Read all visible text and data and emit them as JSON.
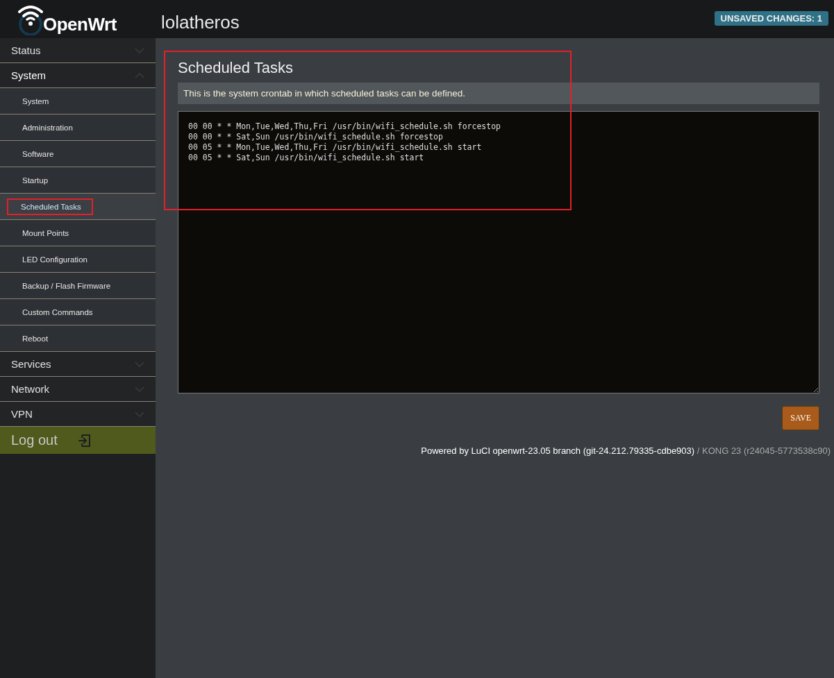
{
  "header": {
    "logo_text": "OpenWrt",
    "hostname": "lolatheros",
    "badge": "UNSAVED CHANGES: 1"
  },
  "sidebar": {
    "items": [
      {
        "label": "Status",
        "expanded": false
      },
      {
        "label": "System",
        "expanded": true,
        "children": [
          {
            "label": "System",
            "selected": false,
            "annotated": false
          },
          {
            "label": "Administration",
            "selected": false,
            "annotated": false
          },
          {
            "label": "Software",
            "selected": false,
            "annotated": false
          },
          {
            "label": "Startup",
            "selected": false,
            "annotated": false
          },
          {
            "label": "Scheduled Tasks",
            "selected": true,
            "annotated": true
          },
          {
            "label": "Mount Points",
            "selected": false,
            "annotated": false
          },
          {
            "label": "LED Configuration",
            "selected": false,
            "annotated": false
          },
          {
            "label": "Backup / Flash Firmware",
            "selected": false,
            "annotated": false
          },
          {
            "label": "Custom Commands",
            "selected": false,
            "annotated": false
          },
          {
            "label": "Reboot",
            "selected": false,
            "annotated": false
          }
        ]
      },
      {
        "label": "Services",
        "expanded": false
      },
      {
        "label": "Network",
        "expanded": false
      },
      {
        "label": "VPN",
        "expanded": false
      }
    ],
    "logout": "Log out"
  },
  "page": {
    "title": "Scheduled Tasks",
    "annotated": true,
    "description": "This is the system crontab in which scheduled tasks can be defined.",
    "crontab": "00 00 * * Mon,Tue,Wed,Thu,Fri /usr/bin/wifi_schedule.sh forcestop\n00 00 * * Sat,Sun /usr/bin/wifi_schedule.sh forcestop\n00 05 * * Mon,Tue,Wed,Thu,Fri /usr/bin/wifi_schedule.sh start\n00 05 * * Sat,Sun /usr/bin/wifi_schedule.sh start",
    "save_button": "SAVE"
  },
  "footer": {
    "powered_by": "Powered by LuCI openwrt-23.05 branch (git-24.212.79335-cdbe903)",
    "version": "/ KONG 23 (r24045-5773538c90)"
  }
}
